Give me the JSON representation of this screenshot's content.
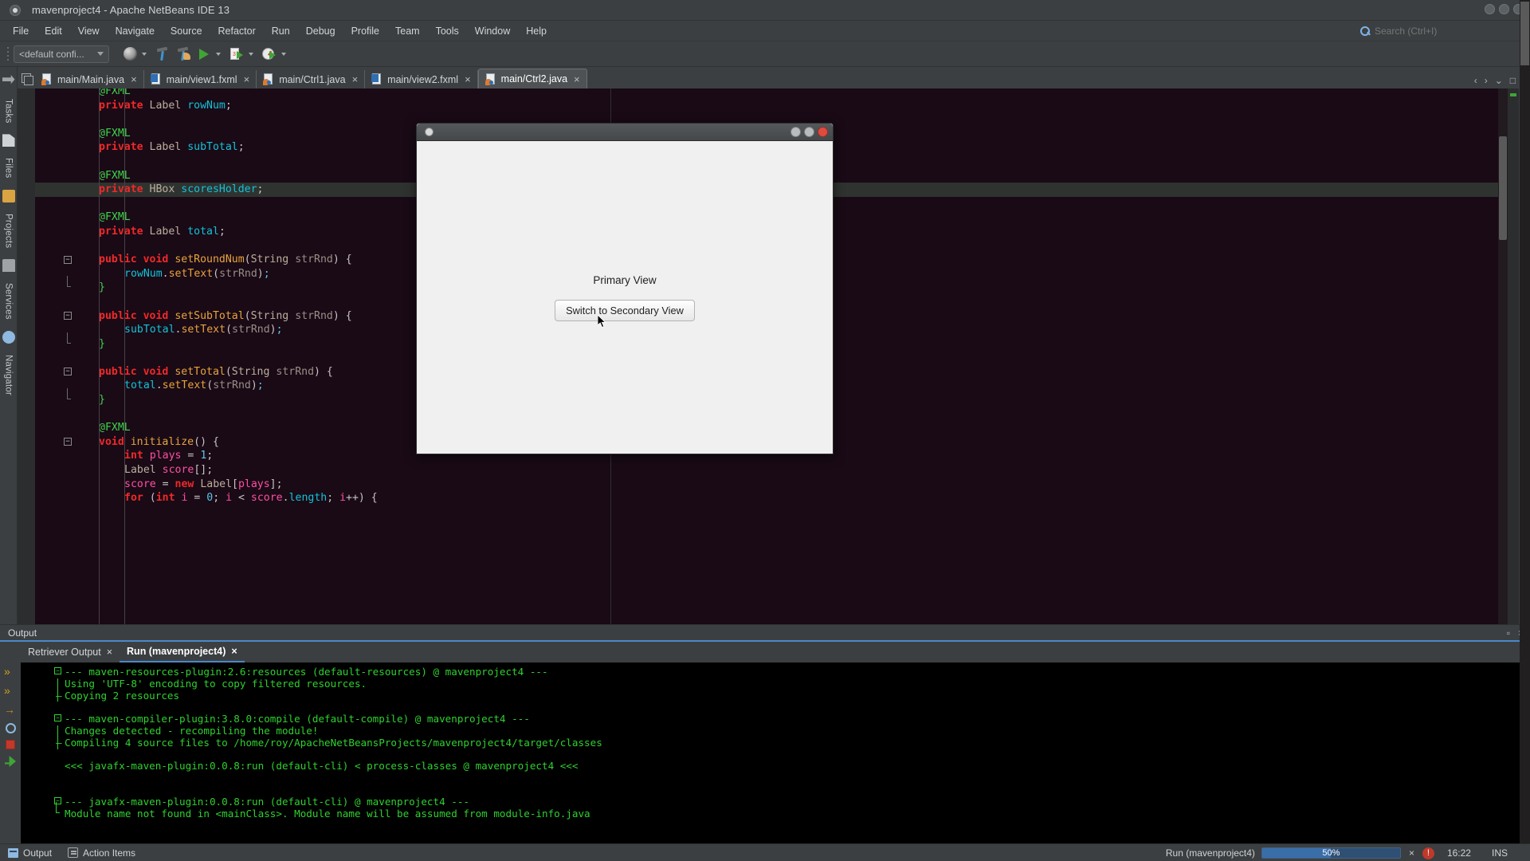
{
  "window": {
    "title": "mavenproject4 - Apache NetBeans IDE 13",
    "app_icon": "netbeans-icon",
    "controls": {
      "minimize": "minimize-icon",
      "maximize": "maximize-icon",
      "close": "close-icon"
    }
  },
  "menubar": {
    "items": [
      "File",
      "Edit",
      "View",
      "Navigate",
      "Source",
      "Refactor",
      "Run",
      "Debug",
      "Profile",
      "Team",
      "Tools",
      "Window",
      "Help"
    ],
    "search_placeholder": "Search (Ctrl+I)",
    "search_icon": "search-icon"
  },
  "toolbar": {
    "config_combo": "<default confi...",
    "icons": [
      "globe-icon",
      "build-icon",
      "clean-build-icon",
      "run-project-icon",
      "debug-project-icon",
      "profile-project-icon"
    ]
  },
  "left_dock": {
    "tabs": [
      "Tasks",
      "Files",
      "Projects",
      "Services",
      "Navigator"
    ]
  },
  "editor": {
    "tabs": [
      {
        "label": "main/Main.java",
        "icon": "java-file-icon",
        "active": false
      },
      {
        "label": "main/view1.fxml",
        "icon": "fxml-file-icon",
        "active": false
      },
      {
        "label": "main/Ctrl1.java",
        "icon": "java-file-icon",
        "active": false
      },
      {
        "label": "main/view2.fxml",
        "icon": "fxml-file-icon",
        "active": false
      },
      {
        "label": "main/Ctrl2.java",
        "icon": "java-file-icon",
        "active": true
      }
    ],
    "close_glyph": "×",
    "nav_left": "‹",
    "nav_right": "›",
    "dropdown": "⌄",
    "maximize": "□",
    "code_lines": [
      {
        "indent": 1,
        "tokens": [
          {
            "t": "@FXML",
            "c": "ann"
          }
        ],
        "clipped": true
      },
      {
        "indent": 1,
        "tokens": [
          {
            "t": "private",
            "c": "kw"
          },
          {
            "t": " ",
            "c": "pun"
          },
          {
            "t": "Label",
            "c": "typ"
          },
          {
            "t": " ",
            "c": "pun"
          },
          {
            "t": "rowNum",
            "c": "var"
          },
          {
            "t": ";",
            "c": "pun"
          }
        ]
      },
      {
        "indent": 0,
        "tokens": []
      },
      {
        "indent": 1,
        "tokens": [
          {
            "t": "@FXML",
            "c": "ann"
          }
        ]
      },
      {
        "indent": 1,
        "tokens": [
          {
            "t": "private",
            "c": "kw"
          },
          {
            "t": " ",
            "c": "pun"
          },
          {
            "t": "Label",
            "c": "typ"
          },
          {
            "t": " ",
            "c": "pun"
          },
          {
            "t": "subTotal",
            "c": "var"
          },
          {
            "t": ";",
            "c": "pun"
          }
        ]
      },
      {
        "indent": 0,
        "tokens": []
      },
      {
        "indent": 1,
        "tokens": [
          {
            "t": "@FXML",
            "c": "ann"
          }
        ]
      },
      {
        "indent": 1,
        "highlight": true,
        "tokens": [
          {
            "t": "private",
            "c": "kw"
          },
          {
            "t": " ",
            "c": "pun"
          },
          {
            "t": "HBox",
            "c": "typ"
          },
          {
            "t": " ",
            "c": "pun"
          },
          {
            "t": "scoresHolder",
            "c": "var"
          },
          {
            "t": ";",
            "c": "pun"
          }
        ]
      },
      {
        "indent": 0,
        "tokens": []
      },
      {
        "indent": 1,
        "tokens": [
          {
            "t": "@FXML",
            "c": "ann"
          }
        ]
      },
      {
        "indent": 1,
        "tokens": [
          {
            "t": "private",
            "c": "kw"
          },
          {
            "t": " ",
            "c": "pun"
          },
          {
            "t": "Label",
            "c": "typ"
          },
          {
            "t": " ",
            "c": "pun"
          },
          {
            "t": "total",
            "c": "var"
          },
          {
            "t": ";",
            "c": "pun"
          }
        ]
      },
      {
        "indent": 0,
        "tokens": []
      },
      {
        "indent": 1,
        "fold": "open",
        "tokens": [
          {
            "t": "public",
            "c": "kw"
          },
          {
            "t": " ",
            "c": "pun"
          },
          {
            "t": "void",
            "c": "kw"
          },
          {
            "t": " ",
            "c": "pun"
          },
          {
            "t": "setRoundNum",
            "c": "mth"
          },
          {
            "t": "(",
            "c": "pun"
          },
          {
            "t": "String",
            "c": "typ"
          },
          {
            "t": " ",
            "c": "pun"
          },
          {
            "t": "strRnd",
            "c": "param"
          },
          {
            "t": ") {",
            "c": "pun"
          }
        ]
      },
      {
        "indent": 2,
        "tokens": [
          {
            "t": "rowNum",
            "c": "var"
          },
          {
            "t": ".",
            "c": "pun"
          },
          {
            "t": "setText",
            "c": "mth"
          },
          {
            "t": "(",
            "c": "pun"
          },
          {
            "t": "strRnd",
            "c": "param"
          },
          {
            "t": ")",
            "c": "pun"
          },
          {
            "t": ";",
            "c": "num"
          }
        ]
      },
      {
        "indent": 1,
        "foldend": true,
        "tokens": [
          {
            "t": "}",
            "c": "brace"
          }
        ]
      },
      {
        "indent": 0,
        "tokens": []
      },
      {
        "indent": 1,
        "fold": "open",
        "tokens": [
          {
            "t": "public",
            "c": "kw"
          },
          {
            "t": " ",
            "c": "pun"
          },
          {
            "t": "void",
            "c": "kw"
          },
          {
            "t": " ",
            "c": "pun"
          },
          {
            "t": "setSubTotal",
            "c": "mth"
          },
          {
            "t": "(",
            "c": "pun"
          },
          {
            "t": "String",
            "c": "typ"
          },
          {
            "t": " ",
            "c": "pun"
          },
          {
            "t": "strRnd",
            "c": "param"
          },
          {
            "t": ") {",
            "c": "pun"
          }
        ]
      },
      {
        "indent": 2,
        "tokens": [
          {
            "t": "subTotal",
            "c": "var"
          },
          {
            "t": ".",
            "c": "pun"
          },
          {
            "t": "setText",
            "c": "mth"
          },
          {
            "t": "(",
            "c": "pun"
          },
          {
            "t": "strRnd",
            "c": "param"
          },
          {
            "t": ")",
            "c": "pun"
          },
          {
            "t": ";",
            "c": "num"
          }
        ]
      },
      {
        "indent": 1,
        "foldend": true,
        "tokens": [
          {
            "t": "}",
            "c": "brace"
          }
        ]
      },
      {
        "indent": 0,
        "tokens": []
      },
      {
        "indent": 1,
        "fold": "open",
        "tokens": [
          {
            "t": "public",
            "c": "kw"
          },
          {
            "t": " ",
            "c": "pun"
          },
          {
            "t": "void",
            "c": "kw"
          },
          {
            "t": " ",
            "c": "pun"
          },
          {
            "t": "setTotal",
            "c": "mth"
          },
          {
            "t": "(",
            "c": "pun"
          },
          {
            "t": "String",
            "c": "typ"
          },
          {
            "t": " ",
            "c": "pun"
          },
          {
            "t": "strRnd",
            "c": "param"
          },
          {
            "t": ") {",
            "c": "pun"
          }
        ]
      },
      {
        "indent": 2,
        "tokens": [
          {
            "t": "total",
            "c": "var"
          },
          {
            "t": ".",
            "c": "pun"
          },
          {
            "t": "setText",
            "c": "mth"
          },
          {
            "t": "(",
            "c": "pun"
          },
          {
            "t": "strRnd",
            "c": "param"
          },
          {
            "t": ")",
            "c": "pun"
          },
          {
            "t": ";",
            "c": "num"
          }
        ]
      },
      {
        "indent": 1,
        "foldend": true,
        "tokens": [
          {
            "t": "}",
            "c": "brace"
          }
        ]
      },
      {
        "indent": 0,
        "tokens": []
      },
      {
        "indent": 1,
        "tokens": [
          {
            "t": "@FXML",
            "c": "ann"
          }
        ]
      },
      {
        "indent": 1,
        "fold": "open",
        "tokens": [
          {
            "t": "void",
            "c": "kw"
          },
          {
            "t": " ",
            "c": "pun"
          },
          {
            "t": "initialize",
            "c": "mth"
          },
          {
            "t": "(",
            "c": "pun"
          },
          {
            "t": ") {",
            "c": "pun"
          }
        ]
      },
      {
        "indent": 2,
        "tokens": [
          {
            "t": "int",
            "c": "kw"
          },
          {
            "t": " ",
            "c": "pun"
          },
          {
            "t": "plays",
            "c": "var2"
          },
          {
            "t": " = ",
            "c": "pun"
          },
          {
            "t": "1",
            "c": "num"
          },
          {
            "t": ";",
            "c": "pun"
          }
        ]
      },
      {
        "indent": 2,
        "tokens": [
          {
            "t": "Label",
            "c": "typ"
          },
          {
            "t": " ",
            "c": "pun"
          },
          {
            "t": "score",
            "c": "var2"
          },
          {
            "t": "[];",
            "c": "pun"
          }
        ]
      },
      {
        "indent": 2,
        "tokens": [
          {
            "t": "score",
            "c": "var2"
          },
          {
            "t": " = ",
            "c": "pun"
          },
          {
            "t": "new",
            "c": "kw"
          },
          {
            "t": " ",
            "c": "pun"
          },
          {
            "t": "Label",
            "c": "typ"
          },
          {
            "t": "[",
            "c": "pun"
          },
          {
            "t": "plays",
            "c": "var2"
          },
          {
            "t": "];",
            "c": "pun"
          }
        ]
      },
      {
        "indent": 2,
        "clipped_bottom": true,
        "tokens": [
          {
            "t": "for",
            "c": "kw"
          },
          {
            "t": " (",
            "c": "pun"
          },
          {
            "t": "int",
            "c": "kw"
          },
          {
            "t": " ",
            "c": "pun"
          },
          {
            "t": "i",
            "c": "var2"
          },
          {
            "t": " = ",
            "c": "pun"
          },
          {
            "t": "0",
            "c": "num"
          },
          {
            "t": "; ",
            "c": "pun"
          },
          {
            "t": "i",
            "c": "var2"
          },
          {
            "t": " < ",
            "c": "pun"
          },
          {
            "t": "score",
            "c": "var2"
          },
          {
            "t": ".",
            "c": "pun"
          },
          {
            "t": "length",
            "c": "var"
          },
          {
            "t": "; ",
            "c": "pun"
          },
          {
            "t": "i",
            "c": "var2"
          },
          {
            "t": "++) {",
            "c": "pun"
          }
        ]
      }
    ]
  },
  "fxwindow": {
    "title": "",
    "app_icon": "javafx-app-icon",
    "label": "Primary View",
    "button": "Switch to Secondary View",
    "controls": {
      "minimize": "minimize-icon",
      "maximize": "maximize-icon",
      "close": "close-icon"
    }
  },
  "output": {
    "panel_title": "Output",
    "panel_close": "×",
    "panel_float": "▫",
    "tabs": [
      {
        "label": "Retriever Output",
        "active": false
      },
      {
        "label": "Run (mavenproject4)",
        "active": true
      }
    ],
    "close_glyph": "×",
    "side_icons": [
      "rerun-icon",
      "rerun-icon",
      "next-error-icon",
      "find-icon",
      "stop-icon",
      "run-icon"
    ],
    "lines": [
      {
        "text": "--- maven-resources-plugin:2.6:resources (default-resources) @ mavenproject4 ---",
        "gutter": "fold"
      },
      {
        "text": "Using 'UTF-8' encoding to copy filtered resources.",
        "gutter": "bar"
      },
      {
        "text": "Copying 2 resources",
        "gutter": "dash"
      },
      {
        "text": ""
      },
      {
        "text": "--- maven-compiler-plugin:3.8.0:compile (default-compile) @ mavenproject4 ---",
        "gutter": "fold"
      },
      {
        "text": "Changes detected - recompiling the module!",
        "gutter": "bar"
      },
      {
        "text": "Compiling 4 source files to /home/roy/ApacheNetBeansProjects/mavenproject4/target/classes",
        "gutter": "dash"
      },
      {
        "text": ""
      },
      {
        "text": "<<< javafx-maven-plugin:0.0.8:run (default-cli) < process-classes @ mavenproject4 <<<",
        "gutter": "none"
      },
      {
        "text": ""
      },
      {
        "text": ""
      },
      {
        "text": "--- javafx-maven-plugin:0.0.8:run (default-cli) @ mavenproject4 ---",
        "gutter": "fold"
      },
      {
        "text": "Module name not found in <mainClass>. Module name will be assumed from module-info.java",
        "gutter": "L"
      }
    ]
  },
  "statusbar": {
    "output_label": "Output",
    "output_icon": "output-icon",
    "action_items_label": "Action Items",
    "action_items_icon": "action-items-icon",
    "run_label": "Run (mavenproject4)",
    "progress_percent": "50%",
    "progress_value": 50,
    "cancel_glyph": "×",
    "notification_icon": "notification-icon",
    "time": "16:22",
    "insert_mode": "INS"
  },
  "colors": {
    "accent": "#4a88c7",
    "chrome": "#3c3f41",
    "editor_bg": "#190a16",
    "console_bg": "#000000",
    "console_text": "#2fd12f",
    "close_red": "#e04a3f"
  }
}
